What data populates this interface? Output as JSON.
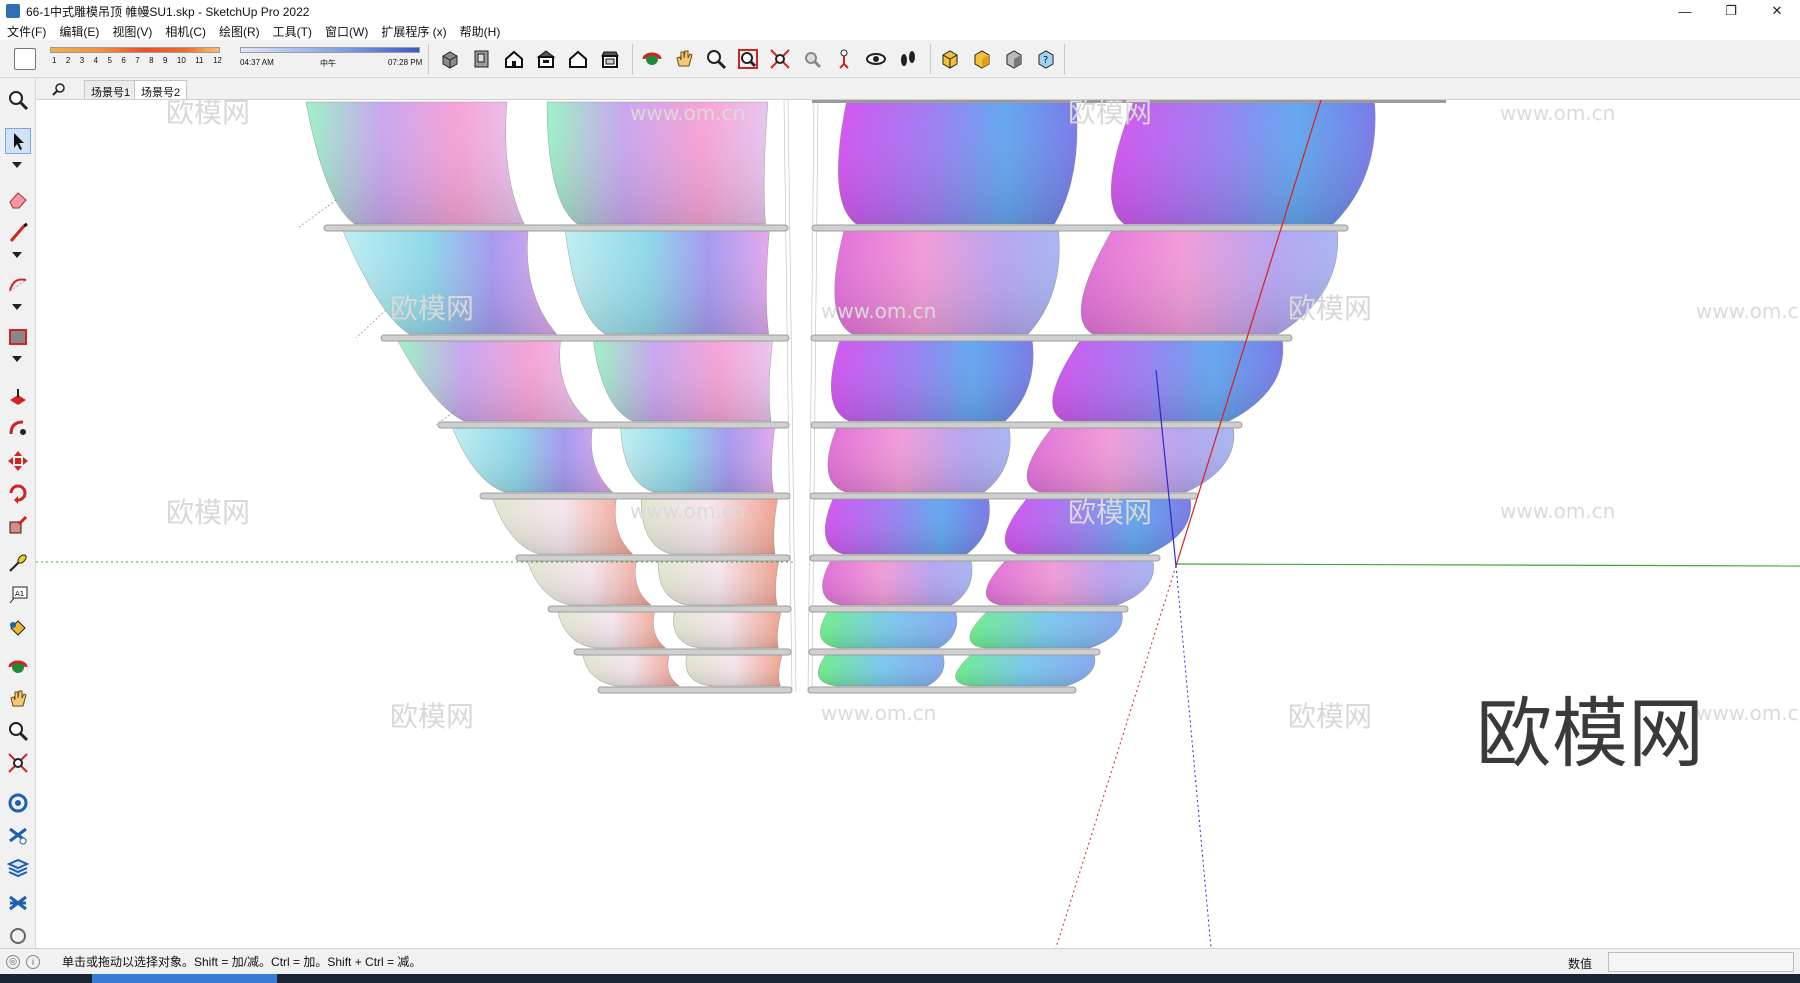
{
  "window": {
    "title": "66-1中式雕模吊顶 帷幔SU1.skp - SketchUp Pro 2022",
    "minimize": "—",
    "restore": "❐",
    "close": "✕"
  },
  "menu": [
    "文件(F)",
    "编辑(E)",
    "视图(V)",
    "相机(C)",
    "绘图(R)",
    "工具(T)",
    "窗口(W)",
    "扩展程序 (x)",
    "帮助(H)"
  ],
  "shadows": {
    "months": [
      "1",
      "2",
      "3",
      "4",
      "5",
      "6",
      "7",
      "8",
      "9",
      "10",
      "11",
      "12"
    ],
    "time_start": "04:37 AM",
    "time_mid": "中午",
    "time_end": "07:28 PM"
  },
  "scenes": {
    "tabs": [
      "场景号1",
      "场景号2"
    ],
    "active_index": 1
  },
  "watermark": {
    "text": "欧模网",
    "url": "www.om.cn",
    "big": "欧模网"
  },
  "status": {
    "message": "单击或拖动以选择对象。Shift = 加/减。Ctrl = 加。Shift + Ctrl = 减。",
    "vcb_label": "数值",
    "vcb_value": ""
  },
  "colors": {
    "red_axis": "#d0241f",
    "green_axis": "#3aa83a",
    "blue_axis": "#2a2ad0",
    "rod": "#c9c9c9"
  }
}
